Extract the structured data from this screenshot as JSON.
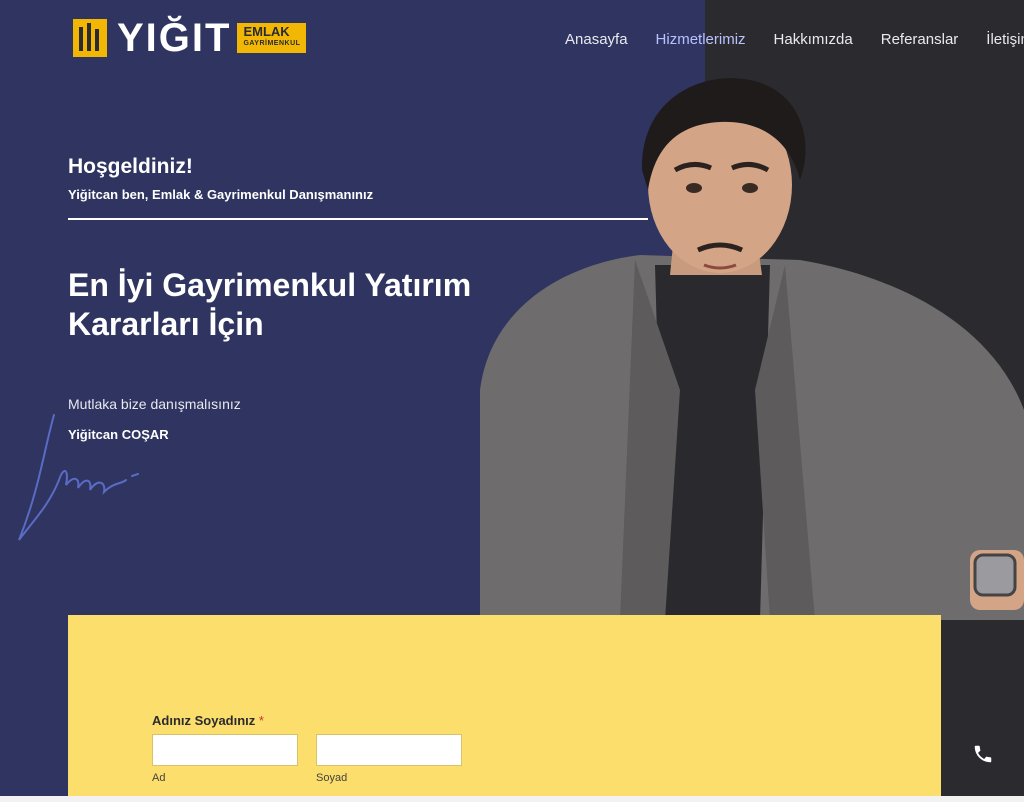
{
  "brand": {
    "name": "YIĞIT",
    "badge_top": "EMLAK",
    "badge_bottom": "GAYRİMENKUL"
  },
  "nav": {
    "items": [
      "Anasayfa",
      "Hizmetlerimiz",
      "Hakkımızda",
      "Referanslar",
      "İletişim"
    ],
    "active": "Hizmetlerimiz"
  },
  "hero": {
    "welcome": "Hoşgeldiniz!",
    "intro": "Yiğitcan ben, Emlak & Gayrimenkul Danışmanınız",
    "headline": "En İyi Gayrimenkul Yatırım Kararları İçin",
    "tagline": "Mutlaka bize danışmalısınız",
    "signer": "Yiğitcan COŞAR"
  },
  "form": {
    "label": "Adınız Soyadınız",
    "required_mark": "*",
    "first_name_sublabel": "Ad",
    "last_name_sublabel": "Soyad",
    "first_name_value": "",
    "last_name_value": ""
  },
  "icons": {
    "phone": "phone-icon"
  },
  "colors": {
    "navy": "#2f3461",
    "dark": "#2b2b2f",
    "yellow": "#fbde6b",
    "accent": "#f2b705"
  }
}
